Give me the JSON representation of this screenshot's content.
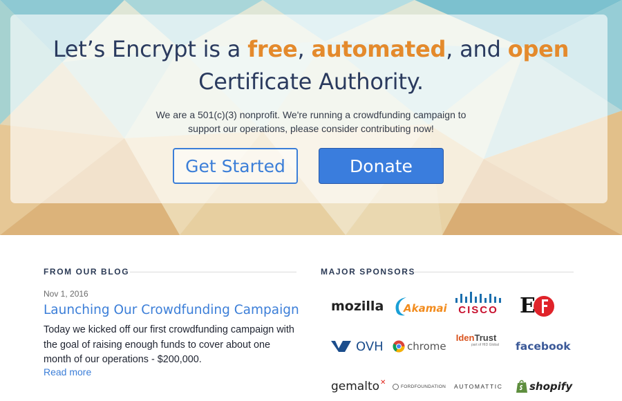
{
  "hero": {
    "headline_part1": "Let’s Encrypt is a ",
    "headline_free": "free",
    "headline_sep1": ", ",
    "headline_automated": "automated",
    "headline_sep2": ", and ",
    "headline_open": "open",
    "headline_line2": "Certificate Authority.",
    "subtext_line1": "We are a 501(c)(3) nonprofit. We're running a crowdfunding campaign to",
    "subtext_line2": "support our operations, please consider contributing now!",
    "get_started_label": "Get Started",
    "donate_label": "Donate",
    "accent_color": "#e48a2c",
    "button_color": "#3a7ddd"
  },
  "blog": {
    "heading": "FROM OUR BLOG",
    "date": "Nov 1, 2016",
    "title": "Launching Our Crowdfunding Campaign",
    "body_lines": [
      "Today we kicked off our first crowdfunding campaign with",
      "the goal of raising enough funds to cover about one",
      "month of our operations - $200,000."
    ],
    "read_more": "Read more"
  },
  "sponsors": {
    "heading": "MAJOR SPONSORS",
    "mozilla": "mozilla",
    "akamai": "Akamai",
    "cisco": "CISCO",
    "eff": "E",
    "ovh": "OVH",
    "chrome": "chrome",
    "identrust_a": "Iden",
    "identrust_b": "Trust",
    "identrust_sub": "part of HID Global",
    "facebook": "facebook",
    "gemalto": "gemalto",
    "ford": "FORDFOUNDATION",
    "automattic": "AUTOMATTIC",
    "shopify": "shopify"
  }
}
